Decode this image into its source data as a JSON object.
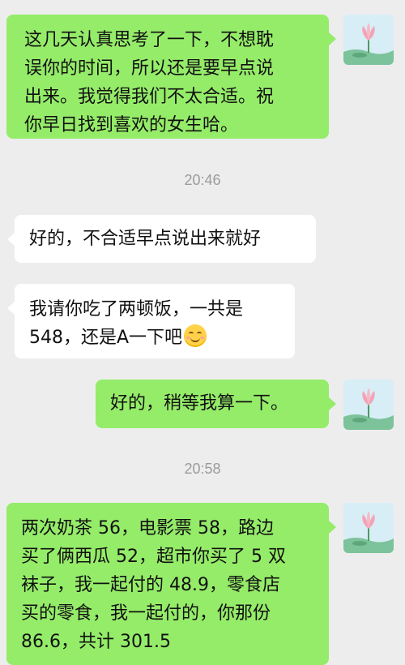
{
  "messages": [
    {
      "sender": "me",
      "text": "这几天认真思考了一下，不想耽\n误你的时间，所以还是要早点说\n出来。我觉得我们不太合适。祝\n你早日找到喜欢的女生哈。"
    },
    {
      "time": "20:46"
    },
    {
      "sender": "other",
      "text": "好的，不合适早点说出来就好"
    },
    {
      "sender": "other",
      "text": "我请你吃了两顿饭，一共是\n548，还是A一下吧",
      "emoji": "smiling-face-icon"
    },
    {
      "sender": "me",
      "text": "好的，稍等我算一下。"
    },
    {
      "time": "20:58"
    },
    {
      "sender": "me",
      "text": "两次奶茶 56，电影票 58，路边\n买了俩西瓜 52，超市你买了 5 双\n袜子，我一起付的 48.9，零食店\n买的零食，我一起付的，你那份\n86.6，共计 301.5"
    }
  ],
  "avatar": {
    "icon": "lotus-avatar-icon"
  },
  "colors": {
    "me_bubble": "#95ec69",
    "other_bubble": "#ffffff",
    "background": "#ededed",
    "timestamp": "#9b9b9b"
  }
}
